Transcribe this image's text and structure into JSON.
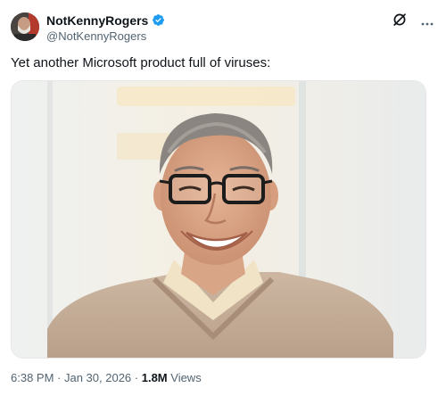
{
  "author": {
    "display_name": "NotKennyRogers",
    "handle": "@NotKennyRogers",
    "verified": true
  },
  "icons": {
    "verified": "verified-badge-icon",
    "grok": "grok-slash-circle-icon",
    "more": "more-horizontal-icon"
  },
  "tweet": {
    "text": "Yet another Microsoft product full of viruses:",
    "time": "6:38 PM",
    "sep1": " · ",
    "date": "Jan 30, 2026",
    "sep2": " · ",
    "views_count": "1.8M",
    "views_label": " Views"
  },
  "colors": {
    "text_primary": "#0f1419",
    "text_secondary": "#536471",
    "verified_blue": "#1d9bf0"
  }
}
